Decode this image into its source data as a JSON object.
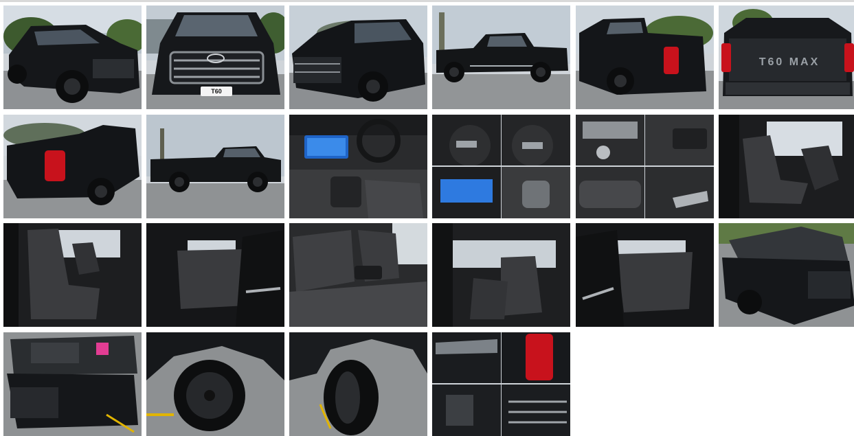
{
  "gallery": {
    "label": "",
    "photos": [
      {
        "subject": "front-three-quarter-left"
      },
      {
        "subject": "front",
        "plate": "T60"
      },
      {
        "subject": "front-three-quarter-right"
      },
      {
        "subject": "side-left"
      },
      {
        "subject": "rear-three-quarter"
      },
      {
        "subject": "rear-tailgate",
        "tailgate_text": "T60 MAX"
      },
      {
        "subject": "rear-three-quarter-left"
      },
      {
        "subject": "side-right"
      },
      {
        "subject": "dashboard"
      },
      {
        "subject": "steering-controls-collage"
      },
      {
        "subject": "console-collage"
      },
      {
        "subject": "front-seats-driver-door"
      },
      {
        "subject": "front-seats-passenger-door"
      },
      {
        "subject": "rear-seats-left-door"
      },
      {
        "subject": "rear-seats-armrest"
      },
      {
        "subject": "interior-from-passenger"
      },
      {
        "subject": "rear-seats-right-door"
      },
      {
        "subject": "front-bonnet-open"
      },
      {
        "subject": "engine-bay"
      },
      {
        "subject": "front-wheel"
      },
      {
        "subject": "rear-wheel"
      },
      {
        "subject": "details-collage"
      }
    ]
  },
  "colors": {
    "vehicle": "#111214",
    "sky": "#c9d2db",
    "tarmac": "#8d8f91",
    "seat": "#3a3b3d",
    "tail_light": "#c8121c"
  }
}
